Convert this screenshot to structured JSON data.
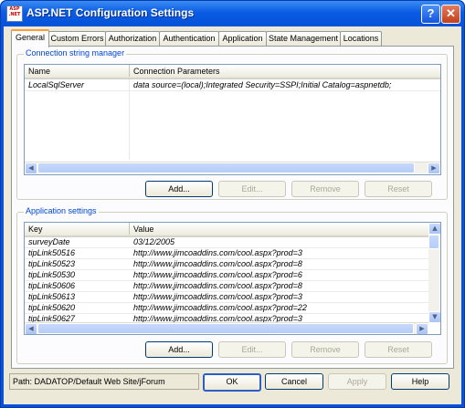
{
  "window": {
    "title": "ASP.NET Configuration Settings",
    "icon_text": "ASP .NET"
  },
  "tabs": [
    {
      "label": "General"
    },
    {
      "label": "Custom Errors"
    },
    {
      "label": "Authorization"
    },
    {
      "label": "Authentication"
    },
    {
      "label": "Application"
    },
    {
      "label": "State Management"
    },
    {
      "label": "Locations"
    }
  ],
  "connection_group": {
    "label": "Connection string manager",
    "headers": {
      "name": "Name",
      "params": "Connection Parameters"
    },
    "rows": [
      {
        "name": "LocalSqlServer",
        "params": "data source=(local);Integrated Security=SSPI;Initial Catalog=aspnetdb;"
      }
    ],
    "buttons": {
      "add": "Add...",
      "edit": "Edit...",
      "remove": "Remove",
      "reset": "Reset"
    }
  },
  "app_group": {
    "label": "Application settings",
    "headers": {
      "key": "Key",
      "value": "Value"
    },
    "rows": [
      {
        "key": "surveyDate",
        "value": "03/12/2005"
      },
      {
        "key": "tipLink50516",
        "value": "http://www.jimcoaddins.com/cool.aspx?prod=3"
      },
      {
        "key": "tipLink50523",
        "value": "http://www.jimcoaddins.com/cool.aspx?prod=8"
      },
      {
        "key": "tipLink50530",
        "value": "http://www.jimcoaddins.com/cool.aspx?prod=6"
      },
      {
        "key": "tipLink50606",
        "value": "http://www.jimcoaddins.com/cool.aspx?prod=8"
      },
      {
        "key": "tipLink50613",
        "value": "http://www.jimcoaddins.com/cool.aspx?prod=3"
      },
      {
        "key": "tipLink50620",
        "value": "http://www.jimcoaddins.com/cool.aspx?prod=22"
      },
      {
        "key": "tipLink50627",
        "value": "http://www.jimcoaddins.com/cool.aspx?prod=3"
      }
    ],
    "buttons": {
      "add": "Add...",
      "edit": "Edit...",
      "remove": "Remove",
      "reset": "Reset"
    }
  },
  "footer": {
    "path": "Path: DADATOP/Default Web Site/jForum",
    "ok": "OK",
    "cancel": "Cancel",
    "apply": "Apply",
    "help": "Help"
  },
  "colors": {
    "titlebar": "#0a5be4",
    "accent_tab": "#ff9d32",
    "group_label": "#0046d5"
  }
}
